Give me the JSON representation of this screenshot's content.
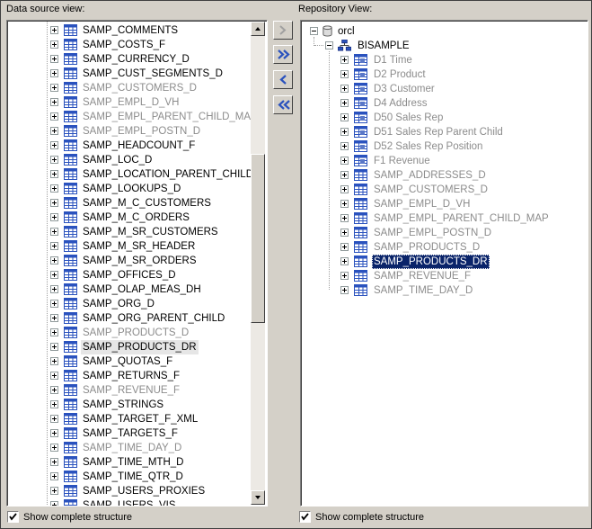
{
  "left_panel": {
    "label": "Data source view:",
    "items": [
      {
        "name": "SAMP_COMMENTS",
        "state": "normal"
      },
      {
        "name": "SAMP_COSTS_F",
        "state": "normal"
      },
      {
        "name": "SAMP_CURRENCY_D",
        "state": "normal"
      },
      {
        "name": "SAMP_CUST_SEGMENTS_D",
        "state": "normal"
      },
      {
        "name": "SAMP_CUSTOMERS_D",
        "state": "gray"
      },
      {
        "name": "SAMP_EMPL_D_VH",
        "state": "gray"
      },
      {
        "name": "SAMP_EMPL_PARENT_CHILD_MAP",
        "state": "gray"
      },
      {
        "name": "SAMP_EMPL_POSTN_D",
        "state": "gray"
      },
      {
        "name": "SAMP_HEADCOUNT_F",
        "state": "normal"
      },
      {
        "name": "SAMP_LOC_D",
        "state": "normal"
      },
      {
        "name": "SAMP_LOCATION_PARENT_CHILD",
        "state": "normal"
      },
      {
        "name": "SAMP_LOOKUPS_D",
        "state": "normal"
      },
      {
        "name": "SAMP_M_C_CUSTOMERS",
        "state": "normal"
      },
      {
        "name": "SAMP_M_C_ORDERS",
        "state": "normal"
      },
      {
        "name": "SAMP_M_SR_CUSTOMERS",
        "state": "normal"
      },
      {
        "name": "SAMP_M_SR_HEADER",
        "state": "normal"
      },
      {
        "name": "SAMP_M_SR_ORDERS",
        "state": "normal"
      },
      {
        "name": "SAMP_OFFICES_D",
        "state": "normal"
      },
      {
        "name": "SAMP_OLAP_MEAS_DH",
        "state": "normal"
      },
      {
        "name": "SAMP_ORG_D",
        "state": "normal"
      },
      {
        "name": "SAMP_ORG_PARENT_CHILD",
        "state": "normal"
      },
      {
        "name": "SAMP_PRODUCTS_D",
        "state": "gray"
      },
      {
        "name": "SAMP_PRODUCTS_DR",
        "state": "selected"
      },
      {
        "name": "SAMP_QUOTAS_F",
        "state": "normal"
      },
      {
        "name": "SAMP_RETURNS_F",
        "state": "normal"
      },
      {
        "name": "SAMP_REVENUE_F",
        "state": "gray"
      },
      {
        "name": "SAMP_STRINGS",
        "state": "normal"
      },
      {
        "name": "SAMP_TARGET_F_XML",
        "state": "normal"
      },
      {
        "name": "SAMP_TARGETS_F",
        "state": "normal"
      },
      {
        "name": "SAMP_TIME_DAY_D",
        "state": "gray"
      },
      {
        "name": "SAMP_TIME_MTH_D",
        "state": "normal"
      },
      {
        "name": "SAMP_TIME_QTR_D",
        "state": "normal"
      },
      {
        "name": "SAMP_USERS_PROXIES",
        "state": "normal"
      },
      {
        "name": "SAMP_USERS_VIS",
        "state": "normal"
      }
    ],
    "checkbox_label": "Show complete structure",
    "checkbox_checked": true
  },
  "right_panel": {
    "label": "Repository View:",
    "root": "orcl",
    "schema": "BISAMPLE",
    "items": [
      {
        "name": "D1 Time",
        "kind": "hier",
        "state": "gray"
      },
      {
        "name": "D2 Product",
        "kind": "hier",
        "state": "gray"
      },
      {
        "name": "D3 Customer",
        "kind": "hier",
        "state": "gray"
      },
      {
        "name": "D4 Address",
        "kind": "hier",
        "state": "gray"
      },
      {
        "name": "D50 Sales Rep",
        "kind": "hier",
        "state": "gray"
      },
      {
        "name": "D51 Sales Rep Parent Child",
        "kind": "hier",
        "state": "gray"
      },
      {
        "name": "D52 Sales Rep Position",
        "kind": "hier",
        "state": "gray"
      },
      {
        "name": "F1 Revenue",
        "kind": "hier",
        "state": "gray"
      },
      {
        "name": "SAMP_ADDRESSES_D",
        "kind": "table",
        "state": "gray"
      },
      {
        "name": "SAMP_CUSTOMERS_D",
        "kind": "table",
        "state": "gray"
      },
      {
        "name": "SAMP_EMPL_D_VH",
        "kind": "table",
        "state": "gray"
      },
      {
        "name": "SAMP_EMPL_PARENT_CHILD_MAP",
        "kind": "table",
        "state": "gray"
      },
      {
        "name": "SAMP_EMPL_POSTN_D",
        "kind": "table",
        "state": "gray"
      },
      {
        "name": "SAMP_PRODUCTS_D",
        "kind": "table",
        "state": "gray"
      },
      {
        "name": "SAMP_PRODUCTS_DR",
        "kind": "table",
        "state": "selected-dark"
      },
      {
        "name": "SAMP_REVENUE_F",
        "kind": "table",
        "state": "gray"
      },
      {
        "name": "SAMP_TIME_DAY_D",
        "kind": "table",
        "state": "gray"
      }
    ],
    "checkbox_label": "Show complete structure",
    "checkbox_checked": true
  },
  "transfer_buttons": [
    {
      "name": "move-right-button",
      "icon": "chevron-right-icon",
      "enabled": false
    },
    {
      "name": "move-all-right-button",
      "icon": "double-chevron-right-icon",
      "enabled": true
    },
    {
      "name": "move-left-button",
      "icon": "chevron-left-icon",
      "enabled": true
    },
    {
      "name": "move-all-left-button",
      "icon": "double-chevron-left-icon",
      "enabled": true
    }
  ],
  "colors": {
    "background": "#d4d0c8",
    "gray_text": "#8c8c8c",
    "selection_dark": "#0a246a",
    "selection_light": "#e6e6e6",
    "icon_blue": "#2a52be"
  }
}
